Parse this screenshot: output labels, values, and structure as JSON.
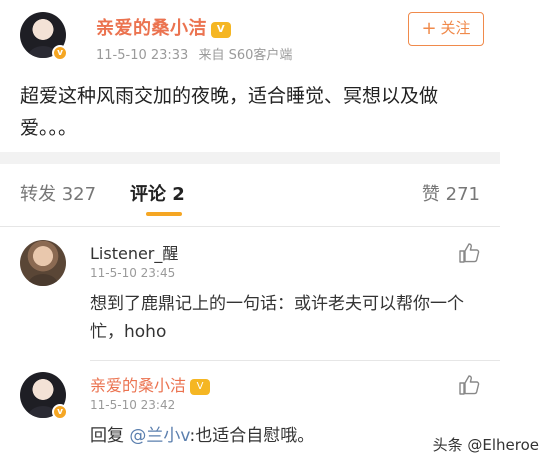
{
  "post": {
    "username": "亲爱的桑小洁",
    "crown_label": "V",
    "verified_badge": "v",
    "timestamp": "11-5-10 23:33",
    "source": "来自 S60客户端",
    "follow_label": "关注",
    "follow_plus": "+",
    "text": "超爱这种风雨交加的夜晚，适合睡觉、冥想以及做爱。。。"
  },
  "tabs": {
    "repost": "转发 327",
    "comment": "评论 2",
    "like": "赞 271"
  },
  "comments": [
    {
      "name": "Listener_醒",
      "time": "11-5-10 23:45",
      "text": "想到了鹿鼎记上的一句话：或许老夫可以帮你一个忙，hoho"
    },
    {
      "name": "亲爱的桑小洁",
      "time": "11-5-10 23:42",
      "reply_prefix": "回复 ",
      "mention": "@兰小v",
      "text_after": ":也适合自慰哦。"
    }
  ],
  "watermark": "头条 @Elheroe",
  "colors": {
    "accent_orange": "#eb7350",
    "badge_gold": "#f5a623",
    "mention_blue": "#5b7fae"
  }
}
